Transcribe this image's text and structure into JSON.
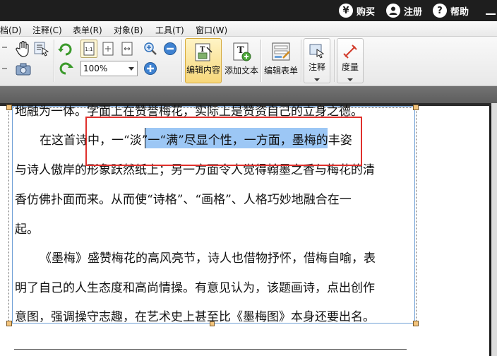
{
  "topbar": {
    "buy_label": "购买",
    "buy_icon": "¥",
    "register_label": "注册",
    "help_label": "帮助",
    "help_icon": "?"
  },
  "menu": {
    "items": [
      "档(D)",
      "注释(C)",
      "表单(R)",
      "对象(B)",
      "工具(T)",
      "窗口(W)"
    ]
  },
  "toolbar": {
    "zoom_value": "100%",
    "edit_content_label": "编辑内容",
    "add_text_label": "添加文本",
    "edit_form_label": "编辑表单",
    "annotate_label": "注释",
    "measure_label": "度量",
    "actual_size_glyph": "1:1",
    "add_text_glyph": "T",
    "colors": {
      "accent_active": "#f7d77a",
      "selection": "#9cc7f5",
      "red_box": "#e0302c"
    }
  },
  "document": {
    "lines": [
      "地融为一体。字面上在赞誉梅花，实际上是赞资自己的立身之德。",
      "在这首诗中，一“淡”一“满”尽显个性，一方面，墨梅的丰姿",
      "与诗人傲岸的形象跃然纸上；另一方面令人觉得翰墨之香与梅花的清",
      "香仿佛扑面而来。从而使“诗格”、“画格”、人格巧妙地融合在一",
      "起。",
      "《墨梅》盛赞梅花的高风亮节，诗人也借物抒怀，借梅自喻，表",
      "明了自己的人生态度和高尚情操。有意见认为，该题画诗，点出创作",
      "意图，强调操守志趣，在艺术史上甚至比《墨梅图》本身还要出名。"
    ]
  }
}
